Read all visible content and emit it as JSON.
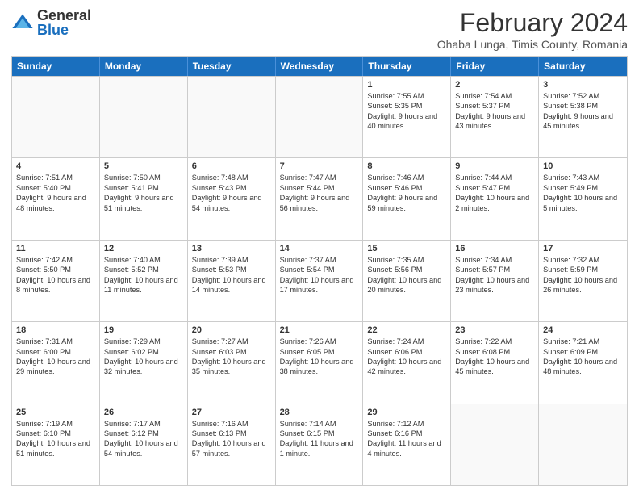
{
  "header": {
    "logo_general": "General",
    "logo_blue": "Blue",
    "month_title": "February 2024",
    "location": "Ohaba Lunga, Timis County, Romania"
  },
  "days_of_week": [
    "Sunday",
    "Monday",
    "Tuesday",
    "Wednesday",
    "Thursday",
    "Friday",
    "Saturday"
  ],
  "weeks": [
    [
      {
        "day": "",
        "text": ""
      },
      {
        "day": "",
        "text": ""
      },
      {
        "day": "",
        "text": ""
      },
      {
        "day": "",
        "text": ""
      },
      {
        "day": "1",
        "text": "Sunrise: 7:55 AM\nSunset: 5:35 PM\nDaylight: 9 hours and 40 minutes."
      },
      {
        "day": "2",
        "text": "Sunrise: 7:54 AM\nSunset: 5:37 PM\nDaylight: 9 hours and 43 minutes."
      },
      {
        "day": "3",
        "text": "Sunrise: 7:52 AM\nSunset: 5:38 PM\nDaylight: 9 hours and 45 minutes."
      }
    ],
    [
      {
        "day": "4",
        "text": "Sunrise: 7:51 AM\nSunset: 5:40 PM\nDaylight: 9 hours and 48 minutes."
      },
      {
        "day": "5",
        "text": "Sunrise: 7:50 AM\nSunset: 5:41 PM\nDaylight: 9 hours and 51 minutes."
      },
      {
        "day": "6",
        "text": "Sunrise: 7:48 AM\nSunset: 5:43 PM\nDaylight: 9 hours and 54 minutes."
      },
      {
        "day": "7",
        "text": "Sunrise: 7:47 AM\nSunset: 5:44 PM\nDaylight: 9 hours and 56 minutes."
      },
      {
        "day": "8",
        "text": "Sunrise: 7:46 AM\nSunset: 5:46 PM\nDaylight: 9 hours and 59 minutes."
      },
      {
        "day": "9",
        "text": "Sunrise: 7:44 AM\nSunset: 5:47 PM\nDaylight: 10 hours and 2 minutes."
      },
      {
        "day": "10",
        "text": "Sunrise: 7:43 AM\nSunset: 5:49 PM\nDaylight: 10 hours and 5 minutes."
      }
    ],
    [
      {
        "day": "11",
        "text": "Sunrise: 7:42 AM\nSunset: 5:50 PM\nDaylight: 10 hours and 8 minutes."
      },
      {
        "day": "12",
        "text": "Sunrise: 7:40 AM\nSunset: 5:52 PM\nDaylight: 10 hours and 11 minutes."
      },
      {
        "day": "13",
        "text": "Sunrise: 7:39 AM\nSunset: 5:53 PM\nDaylight: 10 hours and 14 minutes."
      },
      {
        "day": "14",
        "text": "Sunrise: 7:37 AM\nSunset: 5:54 PM\nDaylight: 10 hours and 17 minutes."
      },
      {
        "day": "15",
        "text": "Sunrise: 7:35 AM\nSunset: 5:56 PM\nDaylight: 10 hours and 20 minutes."
      },
      {
        "day": "16",
        "text": "Sunrise: 7:34 AM\nSunset: 5:57 PM\nDaylight: 10 hours and 23 minutes."
      },
      {
        "day": "17",
        "text": "Sunrise: 7:32 AM\nSunset: 5:59 PM\nDaylight: 10 hours and 26 minutes."
      }
    ],
    [
      {
        "day": "18",
        "text": "Sunrise: 7:31 AM\nSunset: 6:00 PM\nDaylight: 10 hours and 29 minutes."
      },
      {
        "day": "19",
        "text": "Sunrise: 7:29 AM\nSunset: 6:02 PM\nDaylight: 10 hours and 32 minutes."
      },
      {
        "day": "20",
        "text": "Sunrise: 7:27 AM\nSunset: 6:03 PM\nDaylight: 10 hours and 35 minutes."
      },
      {
        "day": "21",
        "text": "Sunrise: 7:26 AM\nSunset: 6:05 PM\nDaylight: 10 hours and 38 minutes."
      },
      {
        "day": "22",
        "text": "Sunrise: 7:24 AM\nSunset: 6:06 PM\nDaylight: 10 hours and 42 minutes."
      },
      {
        "day": "23",
        "text": "Sunrise: 7:22 AM\nSunset: 6:08 PM\nDaylight: 10 hours and 45 minutes."
      },
      {
        "day": "24",
        "text": "Sunrise: 7:21 AM\nSunset: 6:09 PM\nDaylight: 10 hours and 48 minutes."
      }
    ],
    [
      {
        "day": "25",
        "text": "Sunrise: 7:19 AM\nSunset: 6:10 PM\nDaylight: 10 hours and 51 minutes."
      },
      {
        "day": "26",
        "text": "Sunrise: 7:17 AM\nSunset: 6:12 PM\nDaylight: 10 hours and 54 minutes."
      },
      {
        "day": "27",
        "text": "Sunrise: 7:16 AM\nSunset: 6:13 PM\nDaylight: 10 hours and 57 minutes."
      },
      {
        "day": "28",
        "text": "Sunrise: 7:14 AM\nSunset: 6:15 PM\nDaylight: 11 hours and 1 minute."
      },
      {
        "day": "29",
        "text": "Sunrise: 7:12 AM\nSunset: 6:16 PM\nDaylight: 11 hours and 4 minutes."
      },
      {
        "day": "",
        "text": ""
      },
      {
        "day": "",
        "text": ""
      }
    ]
  ]
}
